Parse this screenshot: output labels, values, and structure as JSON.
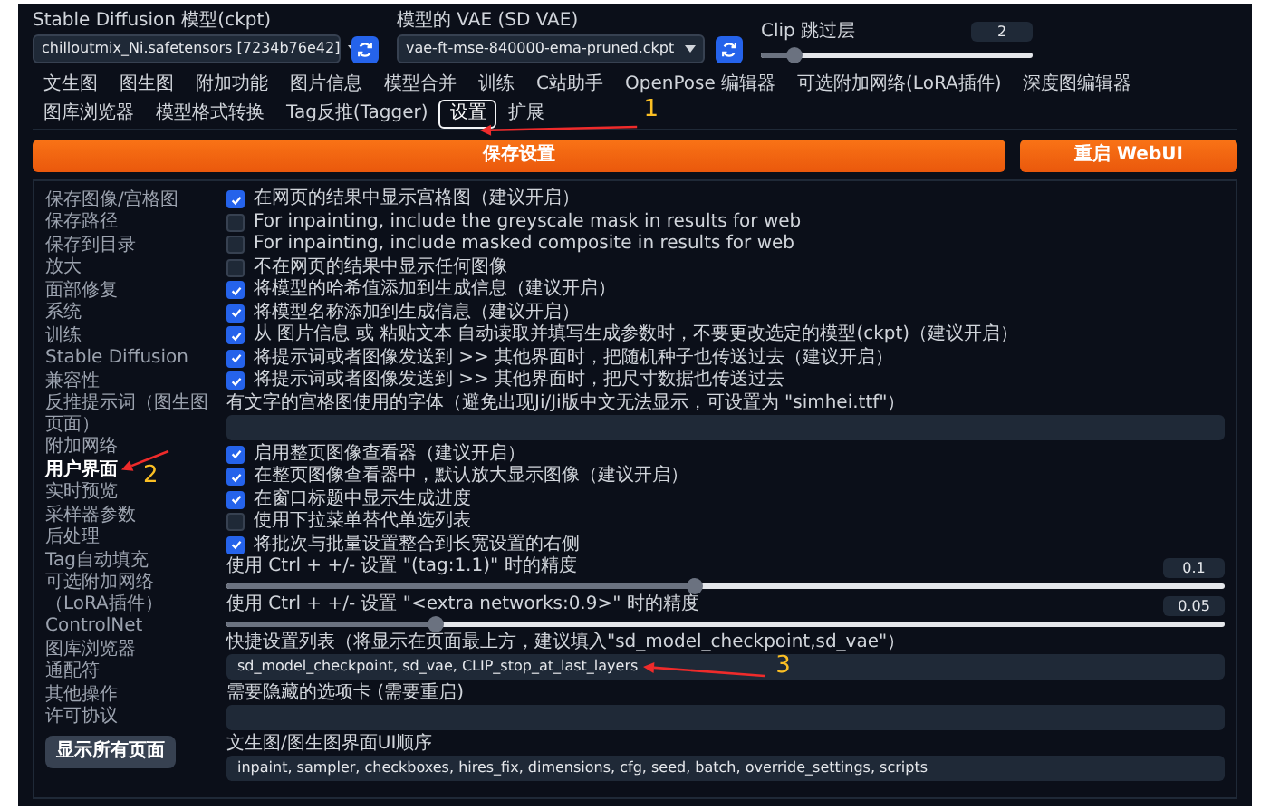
{
  "quick_settings": {
    "model": {
      "label": "Stable Diffusion 模型(ckpt)",
      "value": "chilloutmix_Ni.safetensors [7234b76e42]"
    },
    "vae": {
      "label": "模型的 VAE (SD VAE)",
      "value": "vae-ft-mse-840000-ema-pruned.ckpt"
    },
    "clip_skip": {
      "label": "Clip 跳过层",
      "value": "2",
      "level": 0.12
    }
  },
  "tabs": [
    {
      "label": "文生图",
      "selected": false
    },
    {
      "label": "图生图",
      "selected": false
    },
    {
      "label": "附加功能",
      "selected": false
    },
    {
      "label": "图片信息",
      "selected": false
    },
    {
      "label": "模型合并",
      "selected": false
    },
    {
      "label": "训练",
      "selected": false
    },
    {
      "label": "C站助手",
      "selected": false
    },
    {
      "label": "OpenPose 编辑器",
      "selected": false
    },
    {
      "label": "可选附加网络(LoRA插件)",
      "selected": false
    },
    {
      "label": "深度图编辑器",
      "selected": false
    },
    {
      "label": "图库浏览器",
      "selected": false
    },
    {
      "label": "模型格式转换",
      "selected": false
    },
    {
      "label": "Tag反推(Tagger)",
      "selected": false
    },
    {
      "label": "设置",
      "selected": true,
      "annotation": "1"
    },
    {
      "label": "扩展",
      "selected": false
    }
  ],
  "buttons": {
    "save": "保存设置",
    "restart": "重启 WebUI"
  },
  "sidebar": {
    "items": [
      {
        "label": "保存图像/宫格图",
        "selected": false
      },
      {
        "label": "保存路径",
        "selected": false
      },
      {
        "label": "保存到目录",
        "selected": false
      },
      {
        "label": "放大",
        "selected": false
      },
      {
        "label": "面部修复",
        "selected": false
      },
      {
        "label": "系统",
        "selected": false
      },
      {
        "label": "训练",
        "selected": false
      },
      {
        "label": "Stable Diffusion",
        "selected": false
      },
      {
        "label": "兼容性",
        "selected": false
      },
      {
        "label": "反推提示词（图生图页面）",
        "selected": false
      },
      {
        "label": "附加网络",
        "selected": false
      },
      {
        "label": "用户界面",
        "selected": true,
        "annotation": "2"
      },
      {
        "label": "实时预览",
        "selected": false
      },
      {
        "label": "采样器参数",
        "selected": false
      },
      {
        "label": "后处理",
        "selected": false
      },
      {
        "label": "Tag自动填充",
        "selected": false
      },
      {
        "label": "可选附加网络（LoRA插件）",
        "selected": false
      },
      {
        "label": "ControlNet",
        "selected": false
      },
      {
        "label": "图库浏览器",
        "selected": false
      },
      {
        "label": "通配符",
        "selected": false
      },
      {
        "label": "其他操作",
        "selected": false
      },
      {
        "label": "许可协议",
        "selected": false
      }
    ],
    "button": "显示所有页面"
  },
  "settings": [
    {
      "kind": "checkbox",
      "label": "在网页的结果中显示宫格图（建议开启）",
      "checked": true
    },
    {
      "kind": "checkbox",
      "label": "For inpainting, include the greyscale mask in results for web",
      "checked": false
    },
    {
      "kind": "checkbox",
      "label": "For inpainting, include masked composite in results for web",
      "checked": false
    },
    {
      "kind": "checkbox",
      "label": "不在网页的结果中显示任何图像",
      "checked": false
    },
    {
      "kind": "checkbox",
      "label": "将模型的哈希值添加到生成信息（建议开启）",
      "checked": true
    },
    {
      "kind": "checkbox",
      "label": "将模型名称添加到生成信息（建议开启）",
      "checked": true
    },
    {
      "kind": "checkbox",
      "label": "从 图片信息 或 粘贴文本 自动读取并填写生成参数时，不要更改选定的模型(ckpt)（建议开启）",
      "checked": true
    },
    {
      "kind": "checkbox",
      "label": "将提示词或者图像发送到 >> 其他界面时，把随机种子也传送过去（建议开启）",
      "checked": true
    },
    {
      "kind": "checkbox",
      "label": "将提示词或者图像发送到 >> 其他界面时，把尺寸数据也传送过去",
      "checked": true
    },
    {
      "kind": "textbox",
      "label": "有文字的宫格图使用的字体（避免出现Ji/Ji版中文无法显示，可设置为 \"simhei.ttf\"）"
    },
    {
      "kind": "checkbox",
      "label": "启用整页图像查看器（建议开启）",
      "checked": true
    },
    {
      "kind": "checkbox",
      "label": "在整页图像查看器中，默认放大显示图像（建议开启）",
      "checked": true
    },
    {
      "kind": "checkbox",
      "label": "在窗口标题中显示生成进度",
      "checked": true
    },
    {
      "kind": "checkbox",
      "label": "使用下拉菜单替代单选列表",
      "checked": false
    },
    {
      "kind": "checkbox",
      "label": "将批次与批量设置整合到长宽设置的右侧",
      "checked": true
    },
    {
      "kind": "slider",
      "label": "使用 Ctrl + +/- 设置 \"(tag:1.1)\" 时的精度",
      "value": "0.1",
      "level": 0.47
    },
    {
      "kind": "slider",
      "label": "使用 Ctrl + +/- 设置 \"<extra networks:0.9>\" 时的精度",
      "value": "0.05",
      "level": 0.21
    },
    {
      "kind": "textbox",
      "label": "快捷设置列表（将显示在页面最上方，建议填入\"sd_model_checkpoint,sd_vae\"）",
      "value": "sd_model_checkpoint, sd_vae, CLIP_stop_at_last_layers",
      "annotation": "3"
    },
    {
      "kind": "textbox",
      "label": "需要隐藏的选项卡 (需要重启)"
    },
    {
      "kind": "textbox",
      "label": "文生图/图生图界面UI顺序",
      "value": "inpaint, sampler, checkboxes, hires_fix, dimensions, cfg, seed, batch, override_settings, scripts"
    }
  ]
}
